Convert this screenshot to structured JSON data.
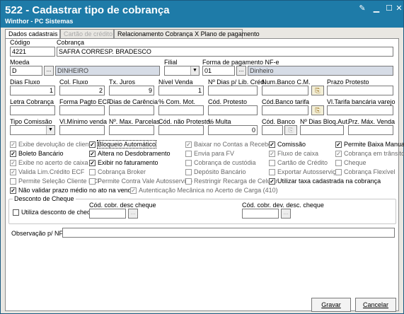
{
  "window": {
    "title": "522 - Cadastrar tipo de cobrança",
    "subtitle": "Winthor - PC Sistemas"
  },
  "tabs": [
    {
      "label": "Dados cadastrais"
    },
    {
      "label": "Cartão de crédito"
    },
    {
      "label": "Relacionamento Cobrança X Plano de pagamento"
    }
  ],
  "fields": {
    "codigo": {
      "label": "Código",
      "value": "4221"
    },
    "cobranca": {
      "label": "Cobrança",
      "value": "SAFRA CORRESP. BRADESCO"
    },
    "moeda": {
      "label": "Moeda",
      "code": "D",
      "desc": "DINHEIRO"
    },
    "filial": {
      "label": "Filial",
      "value": ""
    },
    "forma_pgto": {
      "label": "Forma de pagamento NF-e",
      "code": "01",
      "desc": "Dinheiro"
    },
    "dias_fluxo": {
      "label": "Dias Fluxo",
      "value": "1"
    },
    "col_fluxo": {
      "label": "Col. Fluxo",
      "value": "2"
    },
    "tx_juros": {
      "label": "Tx. Juros",
      "value": "9"
    },
    "nivel_venda": {
      "label": "Nível Venda",
      "value": "1"
    },
    "dias_lib_cred": {
      "label": "Nº Dias p/ Lib. Créd.",
      "value": ""
    },
    "num_banco_cm": {
      "label": "Num.Banco C.M.",
      "value": ""
    },
    "prazo_protesto": {
      "label": "Prazo Protesto",
      "value": ""
    },
    "letra_cobranca": {
      "label": "Letra Cobrança",
      "value": ""
    },
    "forma_pagto_ecf": {
      "label": "Forma Pagto ECF",
      "value": ""
    },
    "dias_carencia": {
      "label": "Dias de Carência",
      "value": ""
    },
    "com_mot": {
      "label": "% Com. Mot.",
      "value": ""
    },
    "cod_protesto": {
      "label": "Cód. Protesto",
      "value": ""
    },
    "cod_banco_tarifa": {
      "label": "Cód.Banco tarifa",
      "value": ""
    },
    "vl_tarifa": {
      "label": "Vl.Tarifa bancária varejo",
      "value": ""
    },
    "tipo_comissao": {
      "label": "Tipo Comissão",
      "value": ""
    },
    "vl_min_venda": {
      "label": "Vl.Mínimo venda",
      "value": ""
    },
    "max_parcelas": {
      "label": "Nº. Max. Parcelas",
      "value": ""
    },
    "cod_nao_protesto": {
      "label": "Cód. não Protesto.",
      "value": ""
    },
    "multa": {
      "label": "% Multa",
      "value": "0"
    },
    "cod_banco": {
      "label": "Cód. Banco",
      "value": ""
    },
    "dias_bloq_aut": {
      "label": "Nº Dias Bloq.Aut.",
      "value": ""
    },
    "prz_max_venda": {
      "label": "Prz. Máx. Venda",
      "value": ""
    }
  },
  "checkboxes": [
    {
      "label": "Exibe devolução de cliente",
      "checked": true,
      "enabled": false
    },
    {
      "label": "Boleto Bancário",
      "checked": true,
      "enabled": true
    },
    {
      "label": "Exibe no acerto de caixa",
      "checked": true,
      "enabled": false
    },
    {
      "label": "Valida Lim.Crédito ECF",
      "checked": true,
      "enabled": false
    },
    {
      "label": "Bloqueio Automático",
      "checked": true,
      "enabled": true
    },
    {
      "label": "Altera no Desdobramento",
      "checked": true,
      "enabled": true
    },
    {
      "label": "Exibir no faturamento",
      "checked": true,
      "enabled": true
    },
    {
      "label": "Cobrança Broker",
      "checked": false,
      "enabled": false
    },
    {
      "label": "Baixar no Contas a Receber",
      "checked": true,
      "enabled": false
    },
    {
      "label": "Envia para FV",
      "checked": false,
      "enabled": false
    },
    {
      "label": "Cobrança de custódia",
      "checked": false,
      "enabled": false
    },
    {
      "label": "Depósito Bancário",
      "checked": false,
      "enabled": false
    },
    {
      "label": "Comissão",
      "checked": true,
      "enabled": true
    },
    {
      "label": "Fluxo de caixa",
      "checked": true,
      "enabled": false
    },
    {
      "label": "Cartão de Crédito",
      "checked": false,
      "enabled": false
    },
    {
      "label": "Exportar Autosserviço",
      "checked": false,
      "enabled": false
    },
    {
      "label": "Permite Baixa Manual",
      "checked": true,
      "enabled": true
    },
    {
      "label": "Cobrança em trânsito",
      "checked": true,
      "enabled": false
    },
    {
      "label": "Cheque",
      "checked": false,
      "enabled": false
    },
    {
      "label": "Cobrança Flexível",
      "checked": false,
      "enabled": false
    },
    {
      "label": "Permite Seleção Cliente ECF",
      "checked": false,
      "enabled": false
    },
    {
      "label": "Permite Contra Vale Autosserviço",
      "checked": false,
      "enabled": false
    },
    {
      "label": "Restringir Recarga de Celular",
      "checked": false,
      "enabled": false
    },
    {
      "label": "Utilizar taxa cadastrada na cobrança",
      "checked": true,
      "enabled": true
    },
    {
      "label": "Não validar prazo médio no ato na venda",
      "checked": true,
      "enabled": true
    },
    {
      "label": "Autenticação Mecânica no Acerto de Carga (410)",
      "checked": true,
      "enabled": false
    }
  ],
  "desconto_cheque": {
    "title": "Desconto de Cheque",
    "utiliza": "Utiliza desconto de cheque",
    "cod_desc": "Cód. cobr. desc cheque",
    "cod_dev": "Cód. cobr. dev. desc. cheque"
  },
  "observacao": {
    "label": "Observação p/ NF:",
    "value": ""
  },
  "buttons": {
    "gravar": "Gravar",
    "cancelar": "Cancelar"
  }
}
